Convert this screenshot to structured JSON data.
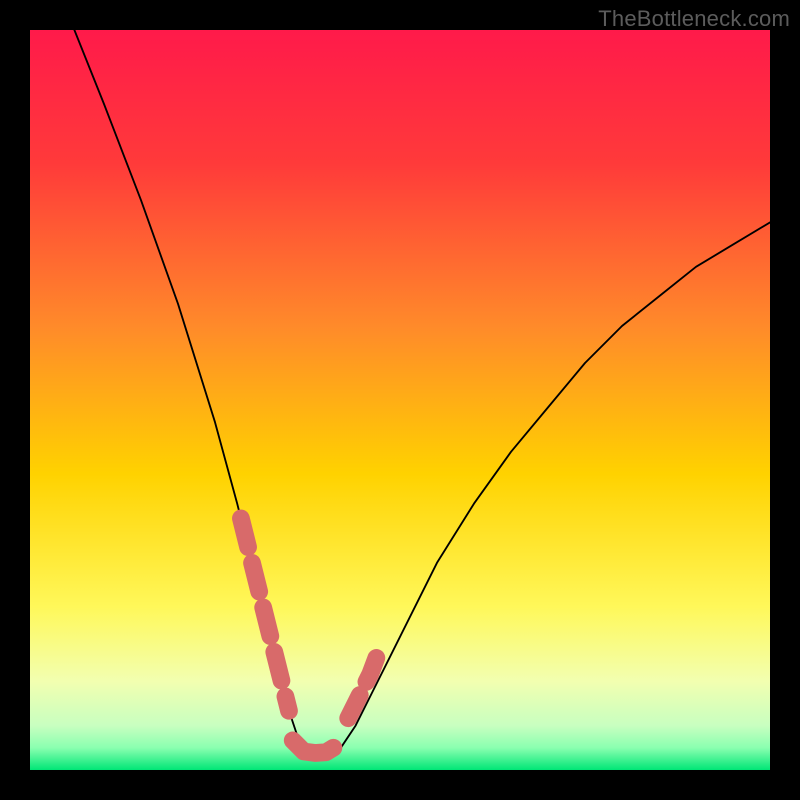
{
  "watermark": "TheBottleneck.com",
  "colors": {
    "bg": "#000000",
    "grad_top": "#ff1a4a",
    "grad_mid1": "#ff6a2a",
    "grad_mid2": "#ffd200",
    "grad_mid3": "#f7ff6a",
    "grad_low": "#d9ffb0",
    "grad_base": "#00e676",
    "curve": "#000000",
    "highlight": "#d86a6a",
    "watermark": "#5c5c5c"
  },
  "chart_data": {
    "type": "line",
    "title": "",
    "xlabel": "",
    "ylabel": "",
    "xlim": [
      0,
      100
    ],
    "ylim": [
      0,
      100
    ],
    "series": [
      {
        "name": "bottleneck-curve",
        "x": [
          6,
          10,
          15,
          20,
          25,
          28,
          30,
          32,
          34,
          35,
          36,
          37,
          38,
          39,
          40,
          42,
          44,
          46,
          50,
          55,
          60,
          65,
          70,
          75,
          80,
          85,
          90,
          95,
          100
        ],
        "y": [
          100,
          90,
          77,
          63,
          47,
          36,
          28,
          20,
          12,
          8,
          5,
          3,
          2,
          2,
          2,
          3,
          6,
          10,
          18,
          28,
          36,
          43,
          49,
          55,
          60,
          64,
          68,
          71,
          74
        ]
      }
    ],
    "highlight_segments": [
      {
        "name": "left-descent",
        "x": [
          28.5,
          30.5,
          31.5,
          33.0,
          34.0,
          35.0
        ],
        "y": [
          34,
          26,
          22,
          16,
          12,
          8
        ]
      },
      {
        "name": "valley-floor",
        "x": [
          35.5,
          37.0,
          38.5,
          40.0,
          41.0
        ],
        "y": [
          4,
          2.5,
          2.3,
          2.4,
          3
        ]
      },
      {
        "name": "right-ascent",
        "x": [
          43.0,
          44.5,
          46.0,
          47.5
        ],
        "y": [
          7,
          10,
          13,
          17
        ]
      }
    ]
  }
}
